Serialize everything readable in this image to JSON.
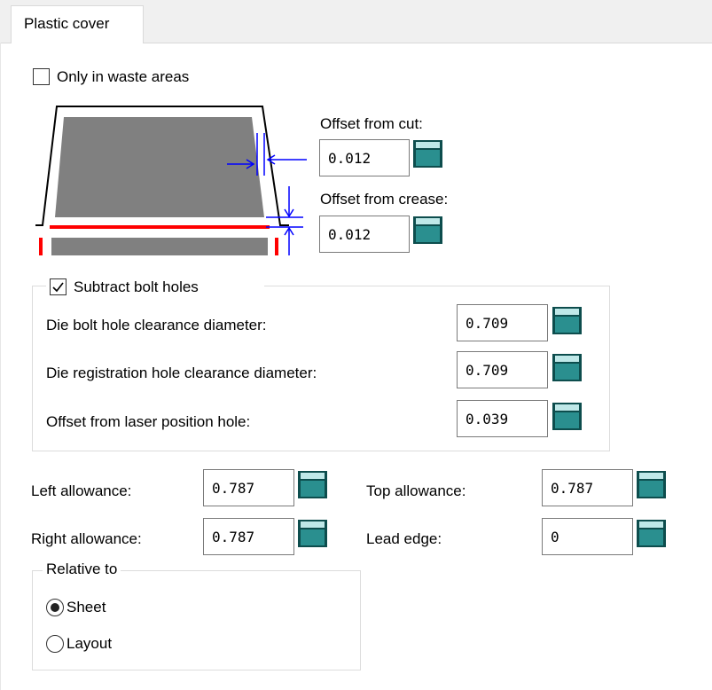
{
  "tab": {
    "label": "Plastic cover"
  },
  "waste": {
    "label": "Only in waste areas",
    "checked": false
  },
  "offset_cut": {
    "label": "Offset from cut:",
    "value": "0.012"
  },
  "offset_crease": {
    "label": "Offset from crease:",
    "value": "0.012"
  },
  "bolt_holes": {
    "label": "Subtract bolt holes",
    "checked": true,
    "rows": [
      {
        "label": "Die bolt hole clearance diameter:",
        "value": "0.709"
      },
      {
        "label": "Die registration hole clearance diameter:",
        "value": "0.709"
      },
      {
        "label": "Offset from laser position hole:",
        "value": "0.039"
      }
    ]
  },
  "allowances": {
    "left": {
      "label": "Left allowance:",
      "value": "0.787"
    },
    "right": {
      "label": "Right allowance:",
      "value": "0.787"
    },
    "top": {
      "label": "Top allowance:",
      "value": "0.787"
    },
    "lead": {
      "label": "Lead edge:",
      "value": "0"
    }
  },
  "relative_to": {
    "legend": "Relative to",
    "options": [
      {
        "label": "Sheet",
        "selected": true
      },
      {
        "label": "Layout",
        "selected": false
      }
    ]
  },
  "colors": {
    "accent_line": "#ff0000",
    "dimension": "#0000ff",
    "calc_teal": "#1a7a7a"
  },
  "icons": {
    "calculator": "calculator-icon"
  }
}
